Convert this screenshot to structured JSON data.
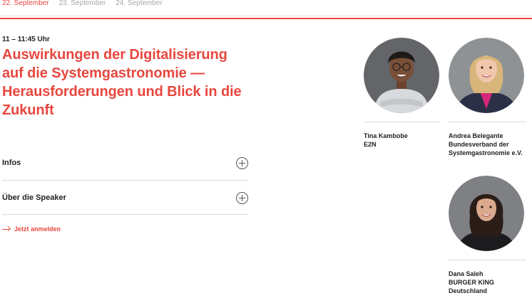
{
  "date_tabs": [
    {
      "label": "22. September",
      "active": true
    },
    {
      "label": "23. September",
      "active": false
    },
    {
      "label": "24. September",
      "active": false
    }
  ],
  "session": {
    "time": "11 – 11:45 Uhr",
    "title": "Auswirkungen der Digitalisierung auf die Systemgastronomie — Herausforderungen und Blick in die Zukunft"
  },
  "accordions": [
    {
      "label": "Infos",
      "icon": "plus-circle-icon"
    },
    {
      "label": "Über die Speaker",
      "icon": "plus-circle-icon"
    }
  ],
  "cta": {
    "label": "Jetzt anmelden",
    "icon": "arrow-right-icon"
  },
  "speakers": [
    {
      "name": "Tina Kambobe",
      "org": "E2N"
    },
    {
      "name": "Andrea Belegante",
      "org": "Bundesverband der\nSystemgastronomie e.V."
    },
    {
      "name": "Dana Saleh",
      "org": "BURGER KING\nDeutschland"
    }
  ],
  "colors": {
    "accent": "#e8473f",
    "text": "#222222",
    "muted": "#a6a6a6",
    "divider": "#dcdcdc"
  }
}
